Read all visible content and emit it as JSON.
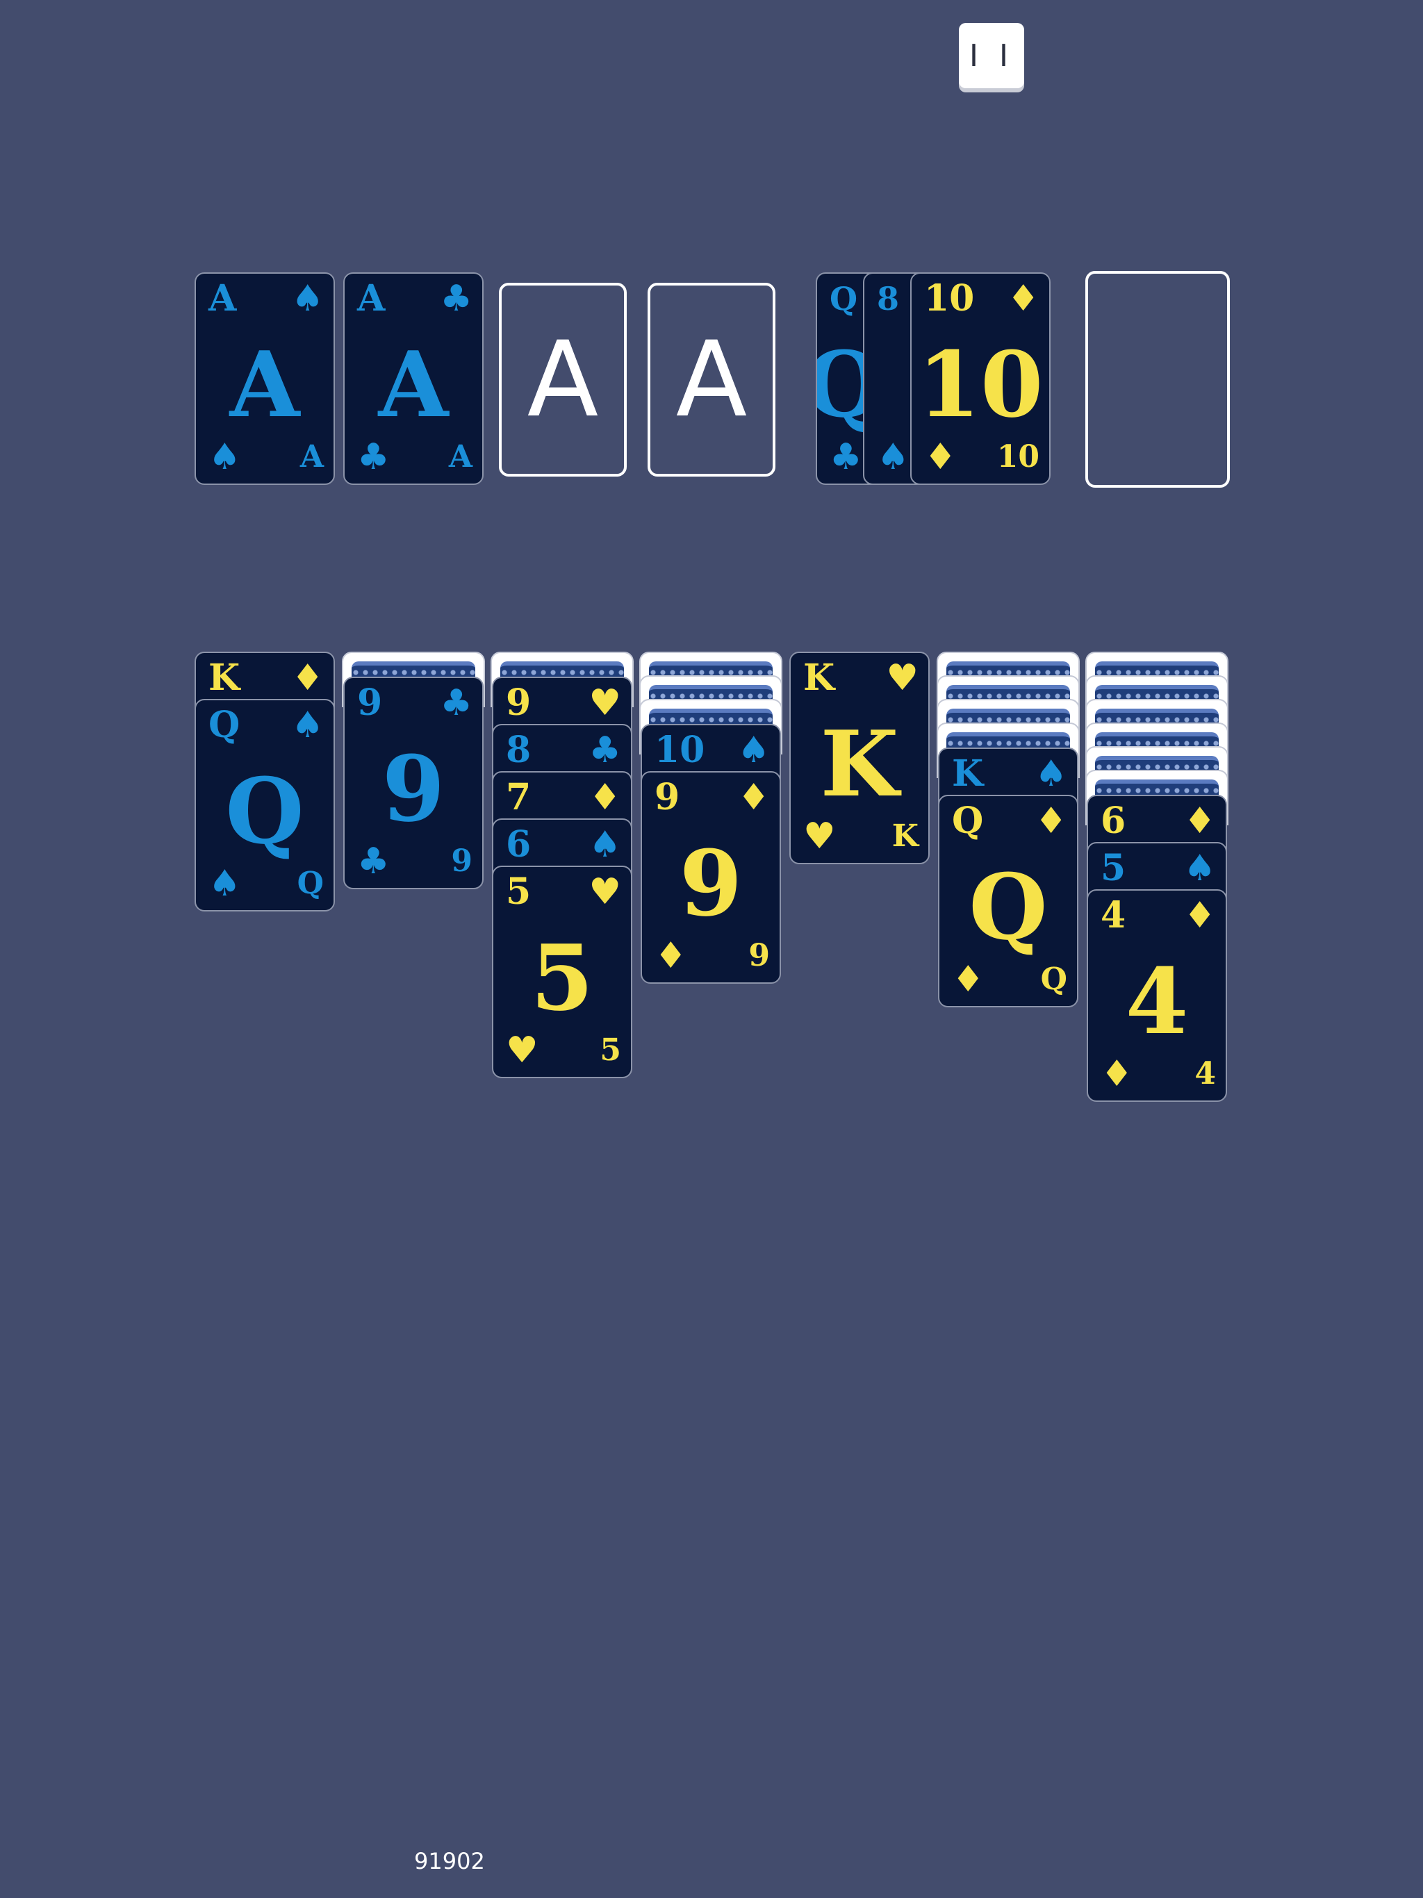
{
  "toolbar": {
    "pause_label": "I I"
  },
  "colors": {
    "background": "#434c6d",
    "black_suit": "#1a8fd9",
    "red_suit": "#f6e24a",
    "card_face": "#081637"
  },
  "foundation": {
    "spades": {
      "rank": "A",
      "suit": "♠",
      "color": "#1a8fd9"
    },
    "clubs": {
      "rank": "A",
      "suit": "♣",
      "color": "#1a8fd9"
    },
    "empty1_label": "A",
    "empty2_label": "A"
  },
  "waste": {
    "card1": {
      "rank": "Q",
      "suit": "♣",
      "color": "#1a8fd9"
    },
    "card2": {
      "rank": "8",
      "suit": "♠",
      "color": "#1a8fd9"
    },
    "card3": {
      "rank": "10",
      "suit": "♦",
      "color": "#f6e24a"
    }
  },
  "tableau": {
    "col1": [
      {
        "rank": "K",
        "suit": "♦",
        "color": "#f6e24a"
      },
      {
        "rank": "Q",
        "suit": "♠",
        "color": "#1a8fd9"
      }
    ],
    "col2": [
      {
        "rank": "9",
        "suit": "♣",
        "color": "#1a8fd9"
      }
    ],
    "col3": [
      {
        "rank": "9",
        "suit": "♥",
        "color": "#f6e24a"
      },
      {
        "rank": "8",
        "suit": "♣",
        "color": "#1a8fd9"
      },
      {
        "rank": "7",
        "suit": "♦",
        "color": "#f6e24a"
      },
      {
        "rank": "6",
        "suit": "♠",
        "color": "#1a8fd9"
      },
      {
        "rank": "5",
        "suit": "♥",
        "color": "#f6e24a"
      }
    ],
    "col4": [
      {
        "rank": "10",
        "suit": "♠",
        "color": "#1a8fd9"
      },
      {
        "rank": "9",
        "suit": "♦",
        "color": "#f6e24a"
      }
    ],
    "col5": [
      {
        "rank": "K",
        "suit": "♥",
        "color": "#f6e24a"
      }
    ],
    "col6": [
      {
        "rank": "K",
        "suit": "♠",
        "color": "#1a8fd9"
      },
      {
        "rank": "Q",
        "suit": "♦",
        "color": "#f6e24a"
      }
    ],
    "col7": [
      {
        "rank": "6",
        "suit": "♦",
        "color": "#f6e24a"
      },
      {
        "rank": "5",
        "suit": "♠",
        "color": "#1a8fd9"
      },
      {
        "rank": "4",
        "suit": "♦",
        "color": "#f6e24a"
      }
    ]
  },
  "status": {
    "score": "91902"
  }
}
